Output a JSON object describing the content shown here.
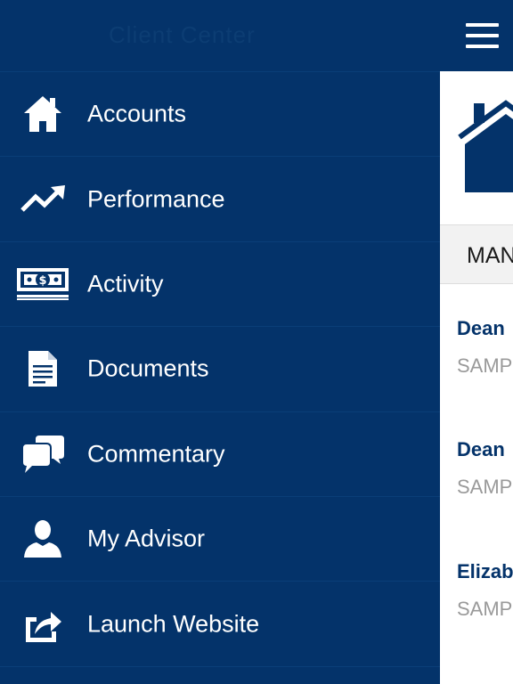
{
  "drawer": {
    "title": "Client Center",
    "items": [
      {
        "label": "Accounts",
        "icon": "home-icon"
      },
      {
        "label": "Performance",
        "icon": "trend-up-icon"
      },
      {
        "label": "Activity",
        "icon": "money-icon"
      },
      {
        "label": "Documents",
        "icon": "document-icon"
      },
      {
        "label": "Commentary",
        "icon": "chat-bubbles-icon"
      },
      {
        "label": "My Advisor",
        "icon": "person-icon"
      },
      {
        "label": "Launch Website",
        "icon": "external-link-icon"
      }
    ]
  },
  "main": {
    "menu_icon": "hamburger-icon",
    "hero_icon": "home-icon",
    "section_title": "MAN",
    "accounts": [
      {
        "name": "Dean",
        "subtitle": "SAMP"
      },
      {
        "name": "Dean",
        "subtitle": "SAMP"
      },
      {
        "name": "Elizab",
        "subtitle": "SAMP"
      }
    ]
  },
  "colors": {
    "primary": "#04336a",
    "drawer_divider": "#0a3e78",
    "text_light": "#ffffff",
    "subtitle_gray": "#9a9a9a",
    "section_bg": "#f2f2f2"
  }
}
